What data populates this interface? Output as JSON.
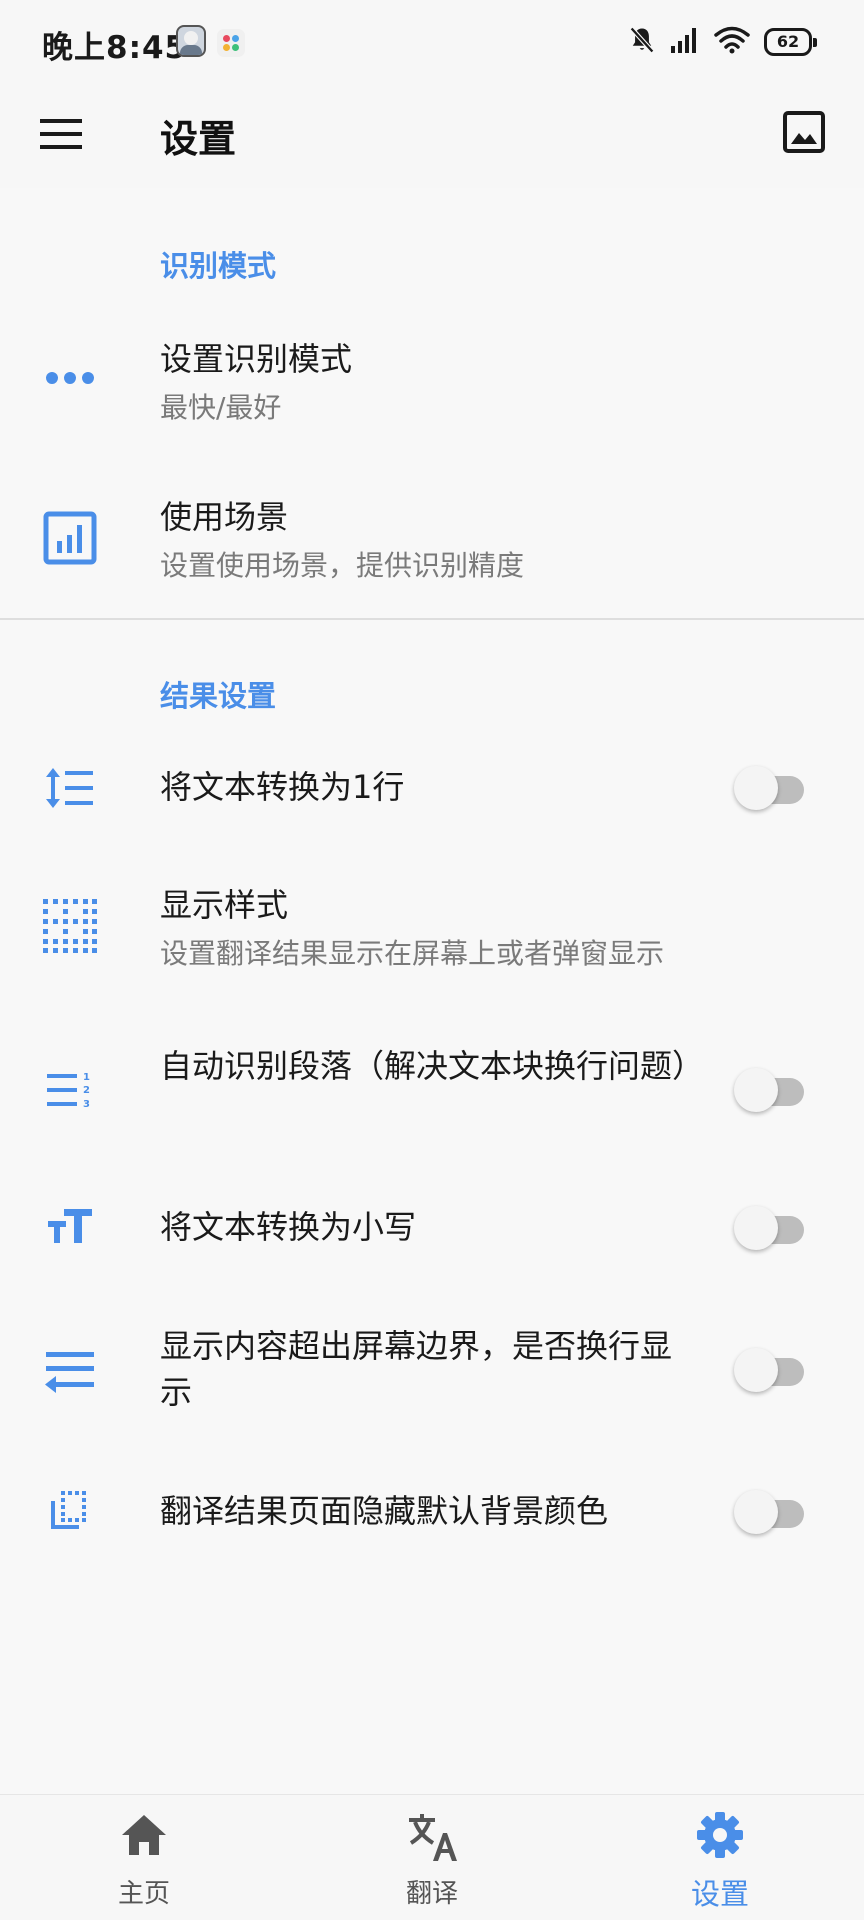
{
  "status_bar": {
    "time": "晚上8:45",
    "battery": "62"
  },
  "app_bar": {
    "title": "设置"
  },
  "sections": {
    "recognition": {
      "header": "识别模式",
      "items": [
        {
          "title": "设置识别模式",
          "subtitle": "最快/最好",
          "icon": "more-horiz-icon"
        },
        {
          "title": "使用场景",
          "subtitle": "设置使用场景，提供识别精度",
          "icon": "bar-chart-icon"
        }
      ]
    },
    "result": {
      "header": "结果设置",
      "items": [
        {
          "title": "将文本转换为1行",
          "icon": "line-spacing-icon",
          "toggle": false
        },
        {
          "title": "显示样式",
          "subtitle": "设置翻译结果显示在屏幕上或者弹窗显示",
          "icon": "dotted-grid-icon"
        },
        {
          "title": "自动识别段落（解决文本块换行问题）",
          "icon": "numbered-list-icon",
          "toggle": false
        },
        {
          "title": "将文本转换为小写",
          "icon": "text-size-icon",
          "toggle": false
        },
        {
          "title": "显示内容超出屏幕边界，是否换行显示",
          "icon": "swap-arrows-icon",
          "toggle": false
        },
        {
          "title": "翻译结果页面隐藏默认背景颜色",
          "icon": "flip-to-back-icon",
          "toggle": false
        }
      ]
    }
  },
  "bottom_nav": {
    "items": [
      {
        "label": "主页",
        "icon": "home-icon",
        "active": false
      },
      {
        "label": "翻译",
        "icon": "translate-icon",
        "active": false
      },
      {
        "label": "设置",
        "icon": "settings-icon",
        "active": true
      }
    ]
  },
  "colors": {
    "accent": "#4a8ee8",
    "text_primary": "#1a1a1a",
    "text_secondary": "#7a7a7a",
    "toggle_off_track": "#bdbdbd"
  }
}
